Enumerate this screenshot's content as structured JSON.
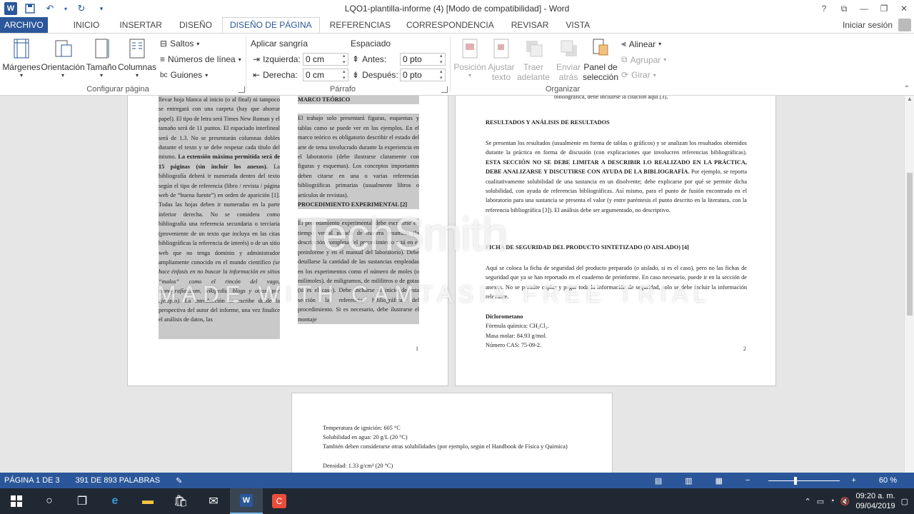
{
  "titlebar": {
    "title": "LQO1-plantilla-informe (4) [Modo de compatibilidad] - Word",
    "help": "?",
    "logo": "W"
  },
  "tabs": {
    "file": "ARCHIVO",
    "items": [
      "INICIO",
      "INSERTAR",
      "DISEÑO",
      "DISEÑO DE PÁGINA",
      "REFERENCIAS",
      "CORRESPONDENCIA",
      "REVISAR",
      "VISTA"
    ],
    "signin": "Iniciar sesión"
  },
  "ribbon": {
    "configurar": {
      "margenes": "Márgenes",
      "orientacion": "Orientación",
      "tamano": "Tamaño",
      "columnas": "Columnas",
      "saltos": "Saltos",
      "numeros": "Números de línea",
      "guiones": "Guiones",
      "label": "Configurar página"
    },
    "parrafo": {
      "sangria": "Aplicar sangría",
      "izquierda": "Izquierda:",
      "izq_val": "0 cm",
      "derecha": "Derecha:",
      "der_val": "0 cm",
      "espaciado": "Espaciado",
      "antes": "Antes:",
      "antes_val": "0 pto",
      "despues": "Después:",
      "despues_val": "0 pto",
      "label": "Párrafo"
    },
    "organizar": {
      "posicion": "Posición",
      "ajustar1": "Ajustar",
      "ajustar2": "texto",
      "traer1": "Traer",
      "traer2": "adelante",
      "enviar1": "Enviar",
      "enviar2": "atrás",
      "panel1": "Panel de",
      "panel2": "selección",
      "alinear": "Alinear",
      "agrupar": "Agrupar",
      "girar": "Girar",
      "label": "Organizar"
    }
  },
  "doc": {
    "p1_colA": "llevar hoja blanca al inicio (o al final) ni tampoco se entregará con una carpeta (hay que ahorrar papel). El tipo de letra será Times New Roman y el tamaño será de 11 puntos. El espaciado interlineal será de 1.3. No se presentarán columnas dobles durante el texto y se debe respetar cada título del mismo.",
    "p1_colA_bold": "La extensión máxima permitida será de 15 páginas (sin incluir los anexos).",
    "p1_colA_2": "La bibliografía deberá ir numerada dentro del texto según el tipo de referencia (libro / revista / página web de “buena fuente”) en orden de aparición [1]. Todas las hojas deben ir numeradas en la parte inferior derecha. No se considera como bibliografía una referencia secundaria o terciaria (proveniente de un texto que incluya en las citas bibliográficas la referencia de interés) o de un sitio web que no tenga dominio y administrador ampliamente conocido en el mundo científico",
    "p1_colA_ital": "(se hace énfasis en no buscar la información en sitios “malos” como el rincón del vago, monografías.com, wikipedia, blogs y otros, por ejemplo).",
    "p1_colA_3": "La introducción se escribe desde la perspectiva del autor del informe, una vez finalice el análisis de datos, las",
    "p1_colB_title": "MARCO TEÓRICO",
    "p1_colB_1": "El trabajo solo presentará figuras, esquemas y tablas como se puede ver en los ejemplos. En el marco teórico es obligatorio describir el estado del arte de tema involucrado durante la experiencia en el laboratorio (debe ilustrarse claramente con figuras y esquemas). Los conceptos importantes deben citarse en una o varias referencias bibliográficas primarias (usualmente libros o artículos de revistas).",
    "p1_colB_title2": "PROCEDIMIENTO EXPERIMENTAL [2]",
    "p1_colB_2": "El procedimiento experimental debe escribirse en tiempo verbal pasado de manera resumida (la descripción completa del procedimiento está en el preinforme y en el manual del laboratorio). Debe detallarse la cantidad de las sustancias empleadas en los experimentos como el número de moles (o milimoles), de miligramos, de mililitros o de gotas (si es el caso). Debe incluirse al inicio de esta sección la referencia bibliográfica del procedimiento. Si es necesario, debe ilustrarse el montaje",
    "p1_num": "1",
    "p2_top": "bibliográfica, debe incluirse la citación aquí [3].",
    "p2_title1": "RESULTADOS Y ANÁLISIS DE RESULTADOS",
    "p2_text1a": "Se presentan los resultados (usualmente en forma de tablas o gráficos) y se analizan los resultados obtenidos durante la práctica en forma de discusión (con explicaciones que involucren referencias bibliográficas).",
    "p2_text1b": "ESTA SECCIÓN NO SE DEBE LIMITAR A DESCRIBIR LO REALIZADO EN LA PRÁCTICA, DEBE ANALIZARSE Y DISCUTIRSE CON AYUDA DE LA BIBLIOGRAFÍA.",
    "p2_text1c": "Por ejemplo, se reporta cualitativamente solubilidad de una sustancia en un disolvente; debe explicarse por qué se permite dicha solubilidad, con ayuda de referencias bibliográficas. Así mismo, para el punto de fusión encontrado en el laboratorio para una sustancia se presenta el valor (y entre paréntesis el punto descrito en la literatura, con la referencia bibliográfica [3]). El análisis debe ser argumentado, no descriptivo.",
    "p2_title2": "FICHA DE SEGURIDAD DEL PRODUCTO SINTETIZADO (O AISLADO) [4]",
    "p2_text2": "Aquí se coloca la ficha de seguridad del producto preparado (o aislado, si es el caso), pero no las fichas de seguridad que ya se han reportado en el cuaderno de preinforme. En caso necesario, puede ir en la sección de anexos. No se permite copiar y pegar toda la información de seguridad, solo se debe incluir la información relevante.",
    "p2_compound": "Diclorometano",
    "p2_formula": "Fórmula química: CH₂Cl₂.",
    "p2_masa": "Masa molar: 84.93 g/mol.",
    "p2_cas": "Número CAS: 75-09-2.",
    "p2_num": "2",
    "p3_l1": "Temperatura de ignición: 605 °C",
    "p3_l2": "Solubilidad en agua: 20 g/L (20 °C)",
    "p3_l3": "También deben considerarse otras solubilidades (por ejemplo, según el Handbook de Física y Química)",
    "p3_l4": "Densidad: 1.33 g/cm³ (20 °C)",
    "watermark": "TechSmith",
    "watermark2": "MADE WITH CAMTASIA FREE TRIAL"
  },
  "status": {
    "page": "PÁGINA 1 DE 3",
    "words": "391 DE 893 PALABRAS",
    "zoom": "60 %",
    "zoom_level": 0.36
  },
  "taskbar": {
    "time": "09:20 a. m.",
    "date": "09/04/2019"
  }
}
